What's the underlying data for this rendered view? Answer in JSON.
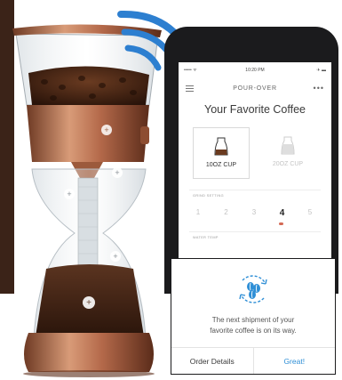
{
  "app": {
    "status": {
      "carrier": "••••• ᯤ",
      "time": "10:20 PM",
      "battery": "✈ ▬"
    },
    "nav": {
      "title": "POUR-OVER",
      "menu_icon": "hamburger-menu-icon",
      "more": "•••"
    },
    "title": "Your Favorite Coffee",
    "cup_options": [
      {
        "label": "10OZ CUP",
        "selected": true
      },
      {
        "label": "20OZ CUP",
        "selected": false
      }
    ],
    "grind_setting": {
      "label": "GRIND SETTING",
      "values": [
        "1",
        "2",
        "3",
        "4",
        "5"
      ],
      "selected": "4"
    },
    "next_section_label": "WATER TEMP"
  },
  "notification": {
    "icon": "coffee-beans-refresh-icon",
    "message_line1": "The next shipment of your",
    "message_line2": "favorite coffee is on its way.",
    "order_details_label": "Order Details",
    "confirm_label": "Great!"
  },
  "colors": {
    "accent_blue": "#2f8fd6",
    "wifi_blue": "#2d7fd0",
    "copper": "#b87150",
    "grind_marker": "#d46a55"
  }
}
